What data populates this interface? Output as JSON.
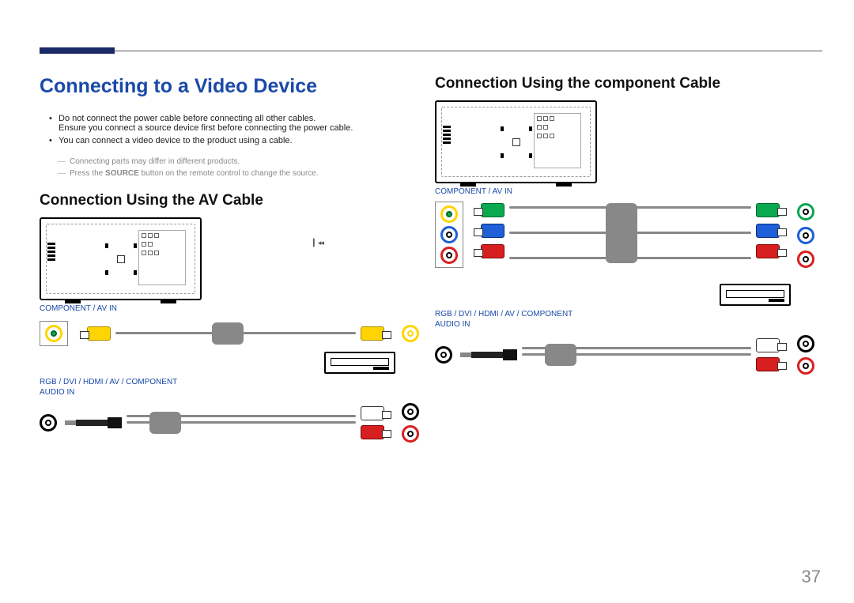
{
  "page_number": "37",
  "main_heading": "Connecting to a Video Device",
  "bullets": [
    "Do not connect the power cable before connecting all other cables.\nEnsure you connect a source device first before connecting the power cable.",
    "You can connect a video device to the product using a cable."
  ],
  "notes": [
    "Connecting parts may differ in different products.",
    "Press the SOURCE button on the remote control to change the source."
  ],
  "notes_prefix": "Press the ",
  "notes_bold": "SOURCE",
  "notes_suffix": " button on the remote control to change the source.",
  "av_heading": "Connection Using the AV Cable",
  "component_heading": "Connection Using the component Cable",
  "label_component_av_in": "COMPONENT / AV IN",
  "label_audio_in": "RGB / DVI / HDMI / AV / COMPONENT\nAUDIO IN",
  "ffwd_glyph": "▎◂◂",
  "av_diagram": {
    "video_jack_color": "green-with-yellow-ring",
    "video_plug_color": "yellow",
    "audio_plugs": [
      "white",
      "red"
    ],
    "audio_in_connector": "3.5mm-stereo",
    "source_device": "dvd-player"
  },
  "component_diagram": {
    "jacks": [
      "green",
      "blue",
      "red"
    ],
    "plugs": [
      "green",
      "blue",
      "red"
    ],
    "audio_plugs": [
      "white",
      "red"
    ],
    "audio_in_connector": "3.5mm-stereo",
    "source_device": "dvd-player"
  }
}
